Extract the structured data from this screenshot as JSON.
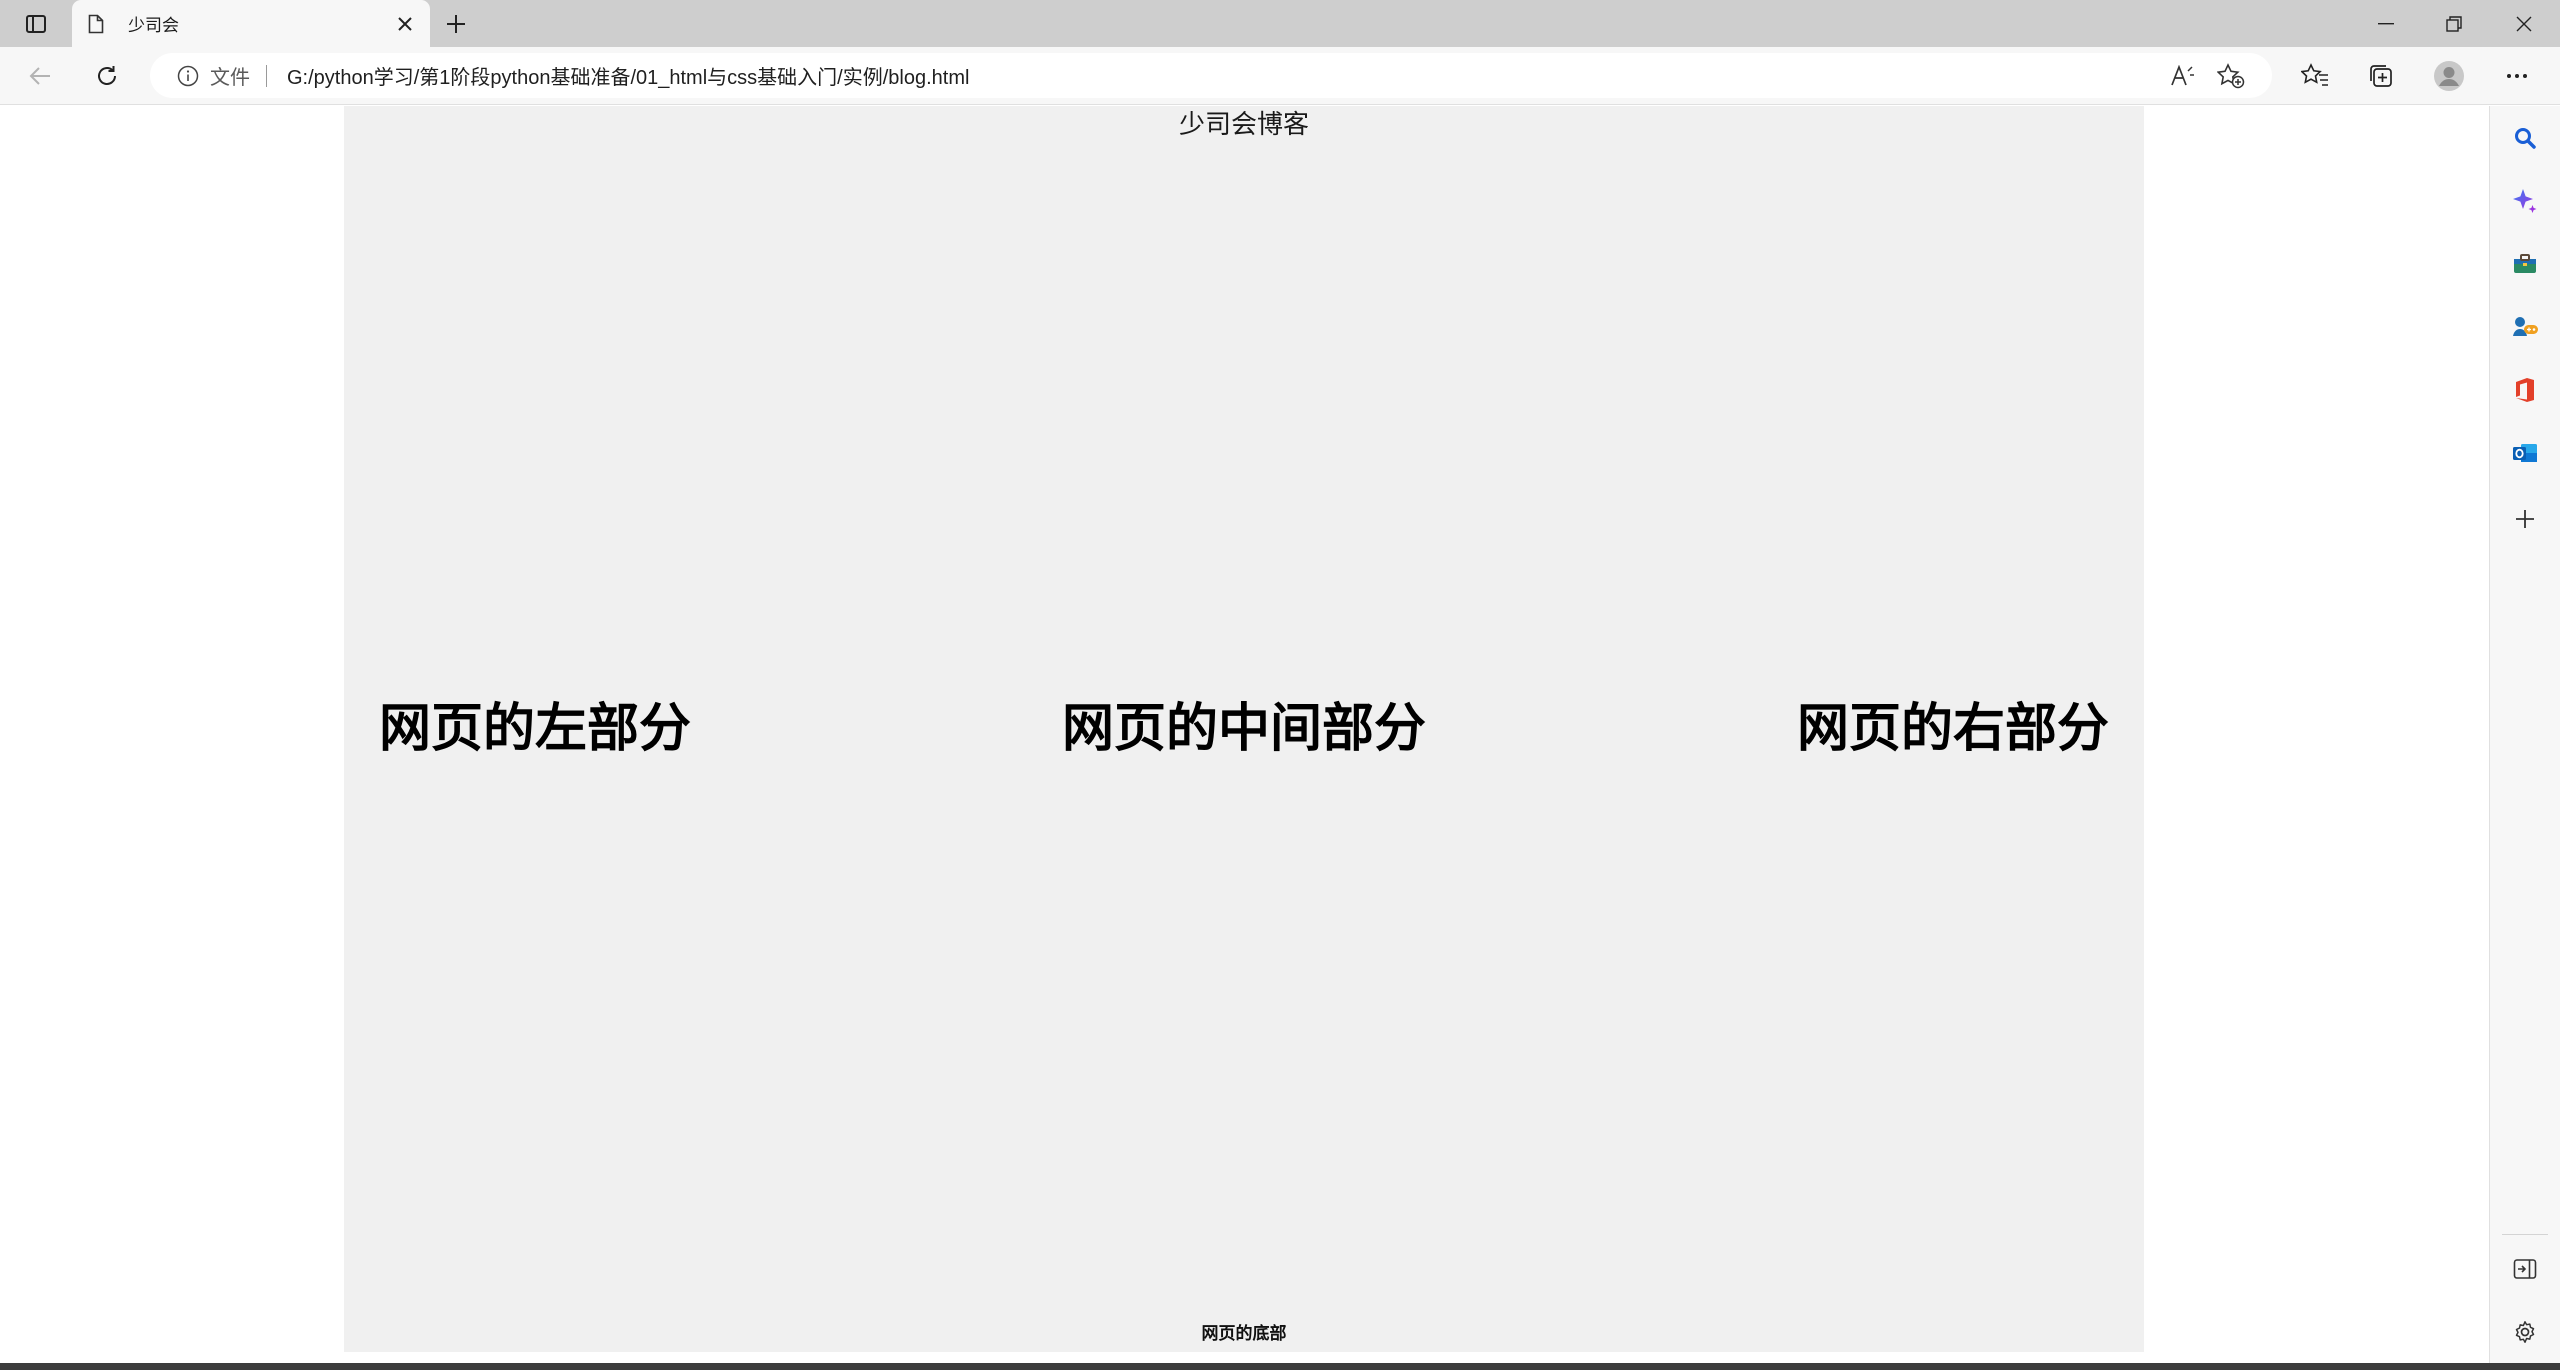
{
  "browser": {
    "tab": {
      "title": "少司会",
      "page_icon": "page-icon",
      "close_icon": "close-icon"
    },
    "new_tab_icon": "plus-icon",
    "window_controls": [
      "minimize-icon",
      "restore-icon",
      "close-icon"
    ],
    "address_bar": {
      "scheme_label": "文件",
      "url": "G:/python学习/第1阶段python基础准备/01_html与css基础入门/实例/blog.html",
      "icons": [
        "read-aloud-icon",
        "add-favorite-icon"
      ]
    },
    "toolbar_icons": [
      "back-icon",
      "refresh-icon",
      "favorites-icon",
      "collections-icon",
      "profile-icon",
      "more-icon"
    ],
    "sidebar_icons": [
      "search-icon",
      "copilot-icon",
      "tools-icon",
      "games-icon",
      "office-icon",
      "outlook-icon",
      "add-icon",
      "hide-sidebar-icon",
      "settings-icon"
    ]
  },
  "page": {
    "header": "少司会博客",
    "left": "网页的左部分",
    "middle": "网页的中间部分",
    "right": "网页的右部分",
    "footer": "网页的底部",
    "background": "#f0f0f0"
  }
}
